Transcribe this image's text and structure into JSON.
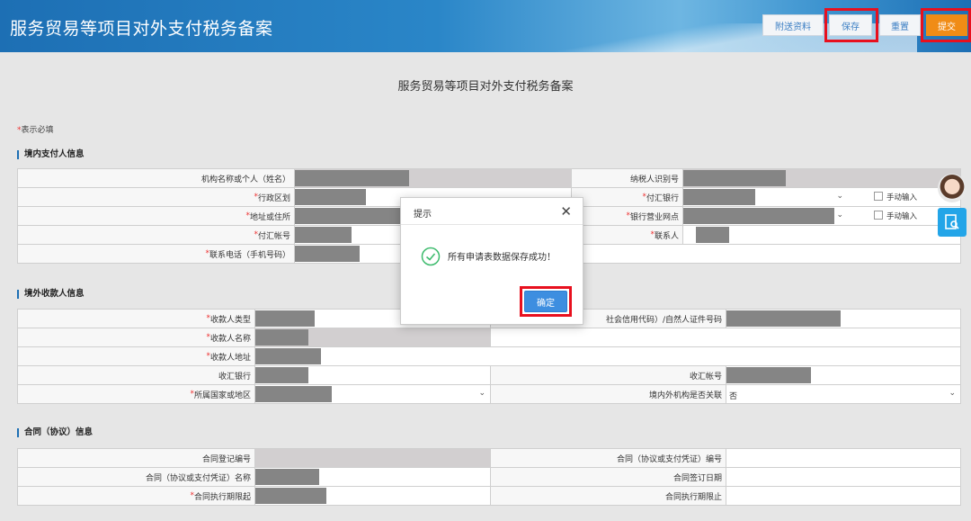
{
  "header": {
    "title": "服务贸易等项目对外支付税务备案",
    "buttons": {
      "attach": "附送资料",
      "save": "保存",
      "reset": "重置",
      "submit": "提交"
    }
  },
  "page_title": "服务贸易等项目对外支付税务备案",
  "required_note": {
    "star": "*",
    "text": "表示必填"
  },
  "sections": {
    "payer": {
      "title": "境内支付人信息",
      "rows": [
        {
          "left_label": "机构名称或个人（姓名）",
          "left_req": "",
          "right_label": "纳税人识别号",
          "right_req": ""
        },
        {
          "left_label": "行政区划",
          "left_req": "*",
          "right_label": "付汇银行",
          "right_req": "*",
          "right_check": "手动输入"
        },
        {
          "left_label": "地址或住所",
          "left_req": "*",
          "right_label": "银行营业网点",
          "right_req": "*",
          "right_check": "手动输入"
        },
        {
          "left_label": "付汇帐号",
          "left_req": "*",
          "right_label": "联系人",
          "right_req": "*"
        },
        {
          "left_label": "联系电话（手机号码）",
          "left_req": "*"
        }
      ]
    },
    "payee": {
      "title": "境外收款人信息",
      "rows": [
        {
          "left_label": "收款人类型",
          "left_req": "*",
          "right_label": "社会信用代码）/自然人证件号码",
          "right_req": ""
        },
        {
          "left_label": "收款人名称",
          "left_req": "*"
        },
        {
          "left_label": "收款人地址",
          "left_req": "*"
        },
        {
          "left_label": "收汇银行",
          "left_req": "",
          "right_label": "收汇帐号",
          "right_req": ""
        },
        {
          "left_label": "所属国家或地区",
          "left_req": "*",
          "right_label": "境内外机构是否关联",
          "right_req": "",
          "right_value": "否"
        }
      ]
    },
    "contract": {
      "title": "合同（协议）信息",
      "rows": [
        {
          "left_label": "合同登记编号",
          "left_req": "",
          "right_label": "合同（协议或支付凭证）编号",
          "right_req": ""
        },
        {
          "left_label": "合同（协议或支付凭证）名称",
          "left_req": "",
          "right_label": "合同签订日期",
          "right_req": ""
        },
        {
          "left_label": "合同执行期限起",
          "left_req": "*",
          "right_label": "合同执行期限止",
          "right_req": ""
        }
      ]
    }
  },
  "dialog": {
    "title": "提示",
    "message": "所有申请表数据保存成功！",
    "ok_label": "确定"
  },
  "colors": {
    "header_blue": "#1d6fb4",
    "submit_orange": "#f08c16",
    "highlight_red": "#e8101e",
    "ok_blue": "#3d8ee0",
    "success_green": "#3dbb6d"
  },
  "icons": [
    "close-icon",
    "success-check-icon",
    "chevron-down-icon",
    "customer-service-avatar-icon",
    "search-doc-icon"
  ]
}
